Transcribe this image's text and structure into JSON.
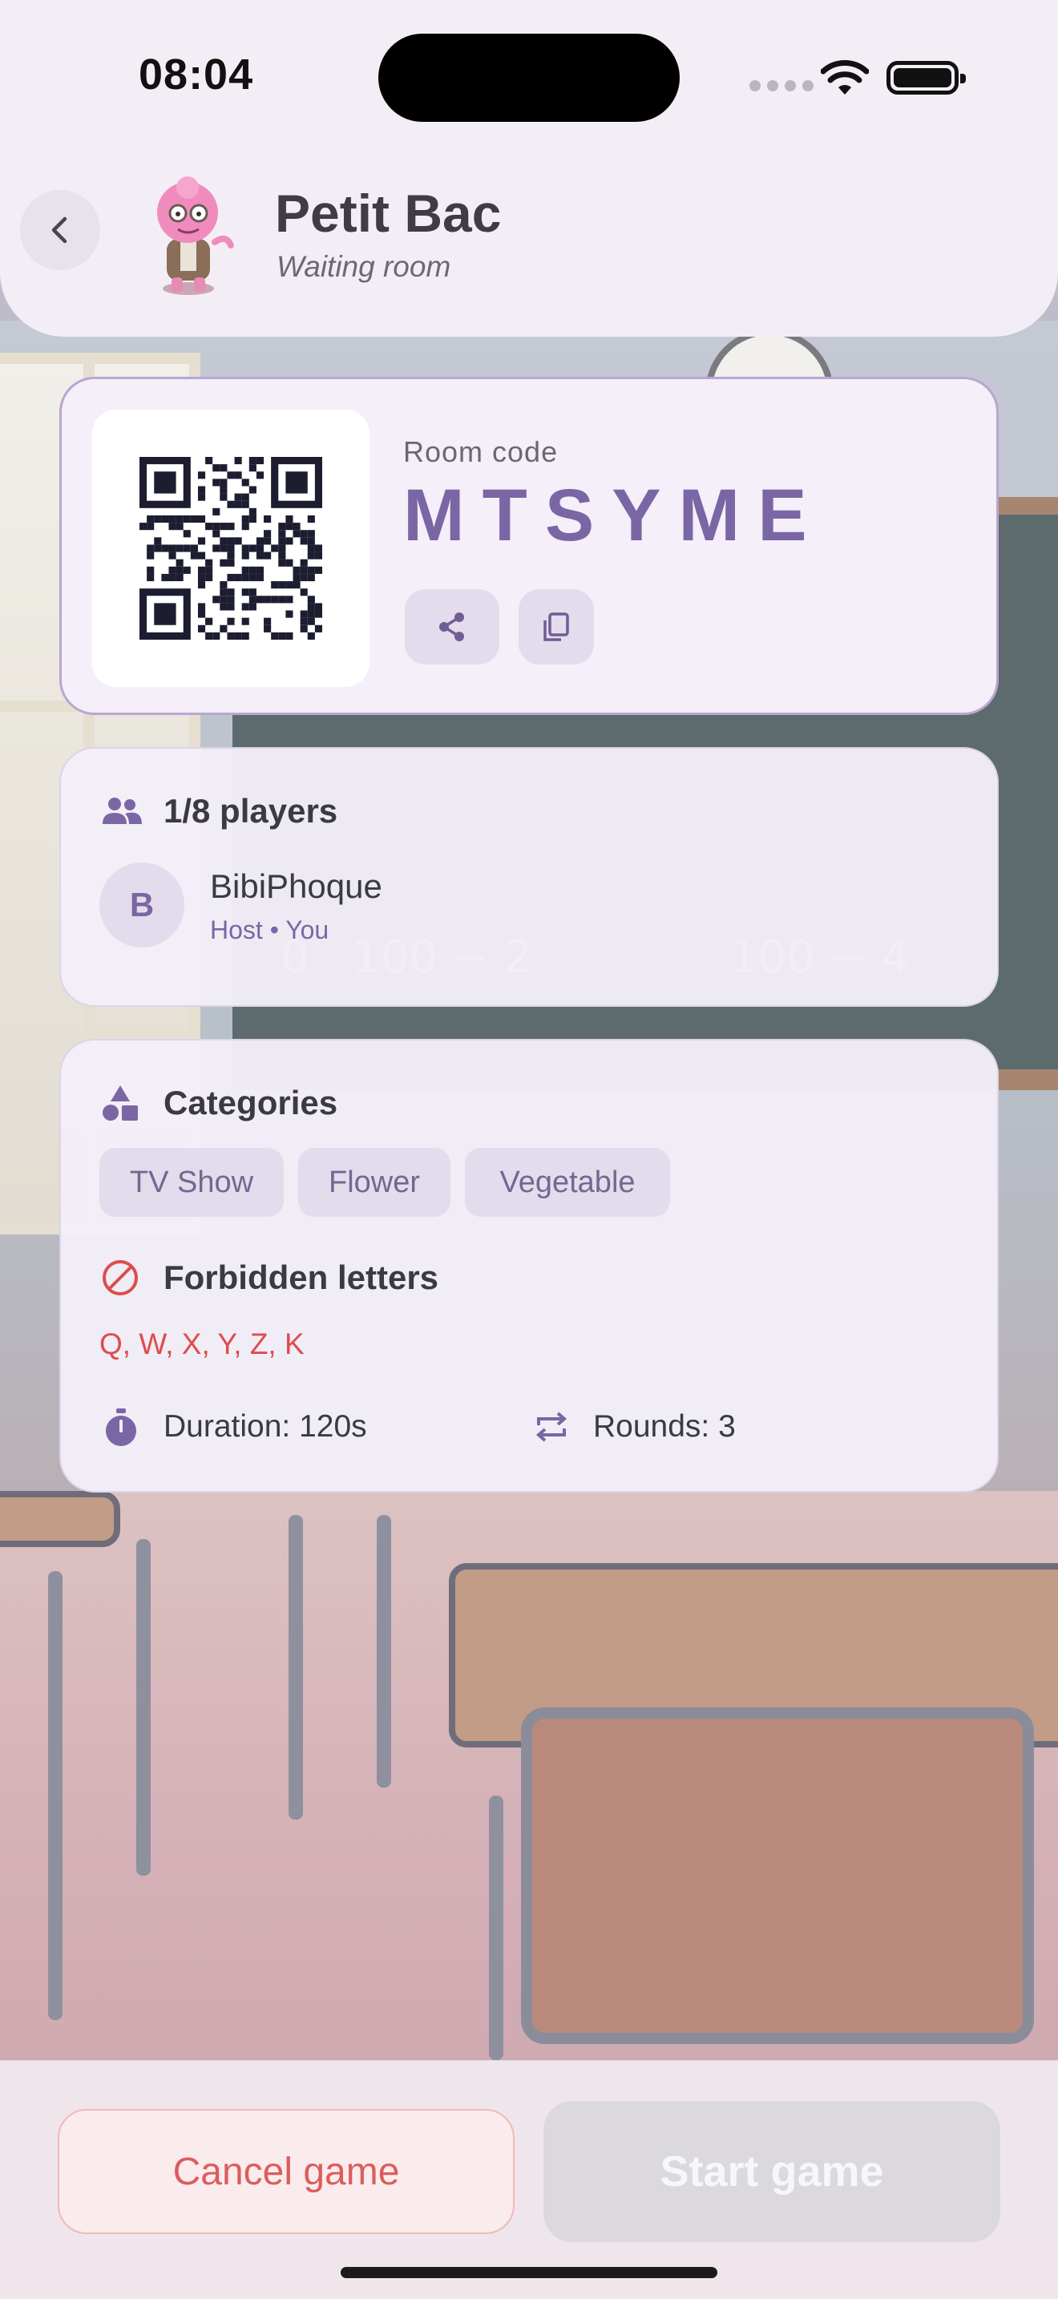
{
  "status_bar": {
    "time": "08:04"
  },
  "header": {
    "title": "Petit Bac",
    "subtitle": "Waiting room"
  },
  "room": {
    "code_label": "Room code",
    "code": "MTSYME"
  },
  "players": {
    "count_label": "1/8 players",
    "list": [
      {
        "initial": "B",
        "name": "BibiPhoque",
        "role": "Host • You"
      }
    ]
  },
  "settings": {
    "categories_title": "Categories",
    "categories": [
      "TV Show",
      "Flower",
      "Vegetable"
    ],
    "forbidden_title": "Forbidden letters",
    "forbidden_letters": "Q, W, X, Y, Z, K",
    "duration": "Duration: 120s",
    "rounds": "Rounds: 3"
  },
  "actions": {
    "cancel_label": "Cancel game",
    "start_label": "Start game"
  },
  "colors": {
    "accent": "#7a66a4",
    "danger": "#dc4d4d",
    "card_background": "#f3eef8",
    "chip_background": "#e3dcec",
    "disabled_button": "#dcd9de"
  },
  "icons": {
    "back": "chevron-left-icon",
    "share": "share-icon",
    "copy": "copy-icon",
    "players": "people-icon",
    "categories": "shapes-icon",
    "forbidden": "prohibited-icon",
    "duration": "stopwatch-icon",
    "rounds": "repeat-icon"
  }
}
